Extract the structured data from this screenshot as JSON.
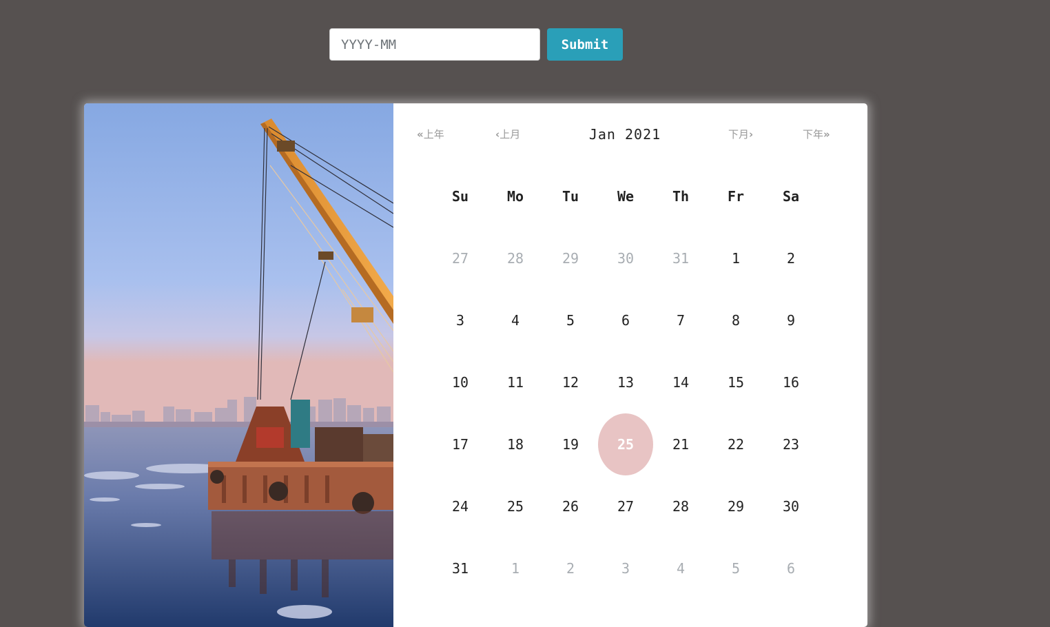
{
  "form": {
    "placeholder": "YYYY-MM",
    "value": "",
    "submit_label": "Submit"
  },
  "calendar": {
    "title": "Jan 2021",
    "nav": {
      "prev_year": "上年",
      "prev_month": "上月",
      "next_month": "下月",
      "next_year": "下年"
    },
    "weekdays": [
      "Su",
      "Mo",
      "Tu",
      "We",
      "Th",
      "Fr",
      "Sa"
    ],
    "weeks": [
      [
        {
          "d": "27",
          "m": true
        },
        {
          "d": "28",
          "m": true
        },
        {
          "d": "29",
          "m": true
        },
        {
          "d": "30",
          "m": true
        },
        {
          "d": "31",
          "m": true
        },
        {
          "d": "1"
        },
        {
          "d": "2"
        }
      ],
      [
        {
          "d": "3"
        },
        {
          "d": "4"
        },
        {
          "d": "5"
        },
        {
          "d": "6"
        },
        {
          "d": "7"
        },
        {
          "d": "8"
        },
        {
          "d": "9"
        }
      ],
      [
        {
          "d": "10"
        },
        {
          "d": "11"
        },
        {
          "d": "12"
        },
        {
          "d": "13"
        },
        {
          "d": "14"
        },
        {
          "d": "15"
        },
        {
          "d": "16"
        }
      ],
      [
        {
          "d": "17"
        },
        {
          "d": "18"
        },
        {
          "d": "19"
        },
        {
          "d": "25",
          "s": true
        },
        {
          "d": "21"
        },
        {
          "d": "22"
        },
        {
          "d": "23"
        }
      ],
      [
        {
          "d": "24"
        },
        {
          "d": "25"
        },
        {
          "d": "26"
        },
        {
          "d": "27"
        },
        {
          "d": "28"
        },
        {
          "d": "29"
        },
        {
          "d": "30"
        }
      ],
      [
        {
          "d": "31"
        },
        {
          "d": "1",
          "m": true
        },
        {
          "d": "2",
          "m": true
        },
        {
          "d": "3",
          "m": true
        },
        {
          "d": "4",
          "m": true
        },
        {
          "d": "5",
          "m": true
        },
        {
          "d": "6",
          "m": true
        }
      ]
    ]
  },
  "colors": {
    "background": "#565150",
    "accent": "#2a9fb8",
    "selected_day": "#e8c4c4",
    "muted_day": "#a8adb2"
  }
}
